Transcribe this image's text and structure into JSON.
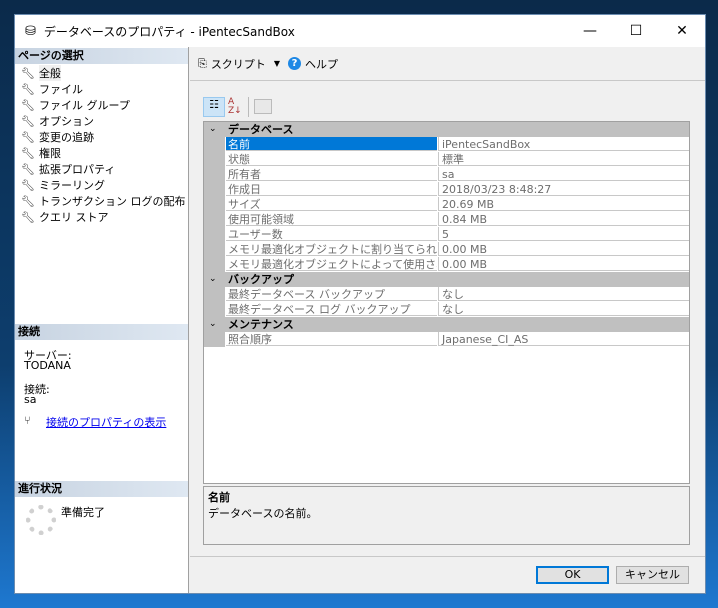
{
  "window": {
    "title": "データベースのプロパティ - iPentecSandBox",
    "minimize": "—",
    "maximize": "☐",
    "close": "✕"
  },
  "left": {
    "page_select_header": "ページの選択",
    "pages": [
      "全般",
      "ファイル",
      "ファイル グループ",
      "オプション",
      "変更の追跡",
      "権限",
      "拡張プロパティ",
      "ミラーリング",
      "トランザクション ログの配布",
      "クエリ ストア"
    ],
    "connection_header": "接続",
    "server_label": "サーバー:",
    "server_value": "TODANA",
    "connection_label": "接続:",
    "connection_value": "sa",
    "view_connection_link": "接続のプロパティの表示",
    "progress_header": "進行状況",
    "progress_status": "準備完了"
  },
  "toolbar": {
    "script_label": "スクリプト",
    "help_label": "ヘルプ"
  },
  "grid": {
    "categories": [
      {
        "label": "データベース",
        "props": [
          {
            "name": "名前",
            "value": "iPentecSandBox"
          },
          {
            "name": "状態",
            "value": "標準"
          },
          {
            "name": "所有者",
            "value": "sa"
          },
          {
            "name": "作成日",
            "value": "2018/03/23 8:48:27"
          },
          {
            "name": "サイズ",
            "value": "20.69 MB"
          },
          {
            "name": "使用可能領域",
            "value": "0.84 MB"
          },
          {
            "name": "ユーザー数",
            "value": "5"
          },
          {
            "name": "メモリ最適化オブジェクトに割り当てられたメモリ",
            "value": "0.00 MB"
          },
          {
            "name": "メモリ最適化オブジェクトによって使用されるメモリ",
            "value": "0.00 MB"
          }
        ]
      },
      {
        "label": "バックアップ",
        "props": [
          {
            "name": "最終データベース バックアップ",
            "value": "なし"
          },
          {
            "name": "最終データベース ログ バックアップ",
            "value": "なし"
          }
        ]
      },
      {
        "label": "メンテナンス",
        "props": [
          {
            "name": "照合順序",
            "value": "Japanese_CI_AS"
          }
        ]
      }
    ]
  },
  "description": {
    "title": "名前",
    "text": "データベースの名前。"
  },
  "buttons": {
    "ok": "OK",
    "cancel": "キャンセル"
  }
}
